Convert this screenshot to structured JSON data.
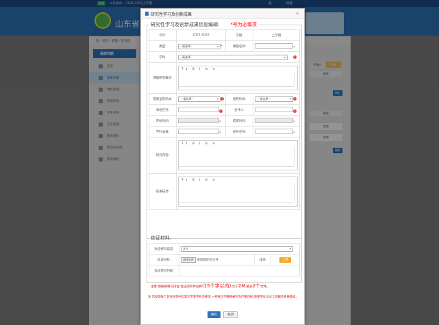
{
  "topbar": {
    "badge": "在线",
    "year": "山东省中... 2021-2022上学期",
    "user": "张",
    "loc": "地理"
  },
  "header": {
    "title": "山东省普"
  },
  "breadcrumb": "首 › 首页 › 管理 › 首页首",
  "sidebar": {
    "heading": "系统导航",
    "items": [
      {
        "label": "首页"
      },
      {
        "label": "成果记录"
      },
      {
        "label": "课程管理"
      },
      {
        "label": "成绩管理"
      },
      {
        "label": "学生名单"
      },
      {
        "label": "学业管理"
      },
      {
        "label": "我的课程"
      },
      {
        "label": "我的班学期"
      },
      {
        "label": "我的课程"
      }
    ]
  },
  "right": {
    "b1": "不通过",
    "b2": "审核",
    "hdr1": "操作",
    "hdr2": "操作",
    "view1": "查看",
    "view2": "查看",
    "go": "确定"
  },
  "modal": {
    "title": "研究性学习及创新成果",
    "close": "×",
    "section1": "研究性学习及创新成果信息编辑:",
    "required_note": "*号为必填项",
    "labels": {
      "school_year": "学年:",
      "semester": "学期:",
      "type": "类型:",
      "topic_name": "课题名称:",
      "subject": "学科:",
      "summary": "课题研究概述:",
      "result_form": "成果呈现形式:",
      "org_form": "组织形式:",
      "role": "承担任务:",
      "collaborators": "合作人:",
      "start_time": "开始时间:",
      "end_time": "结束时间:",
      "hours": "学时总数:",
      "teacher": "指导老师:",
      "content": "研究内容:",
      "description": "成果描述:"
    },
    "values": {
      "school_year": "2021-2022",
      "semester": "上学期"
    },
    "select_placeholder": "--请选择--",
    "select_placeholder2": "---请选择---",
    "editor_toolbar": "T↕ B I ☰ ☷",
    "section2": "佐证材料:",
    "evidence": {
      "type_label": "佐证材料类型:",
      "type_value": "文件",
      "file_label": "佐证材料:",
      "choose_btn": "选择文件",
      "no_file": "未选择任何文件",
      "op": "操作",
      "upload": "上传",
      "list_label": "佐证材料列表:"
    },
    "note1_pre": "注意:请按照填写内容,佐证的文件名称",
    "note1_a": "(15个字以内)",
    "note1_b": ",大小",
    "note1_c": "2M",
    "note1_d": ",最多",
    "note1_e": "2个",
    "note1_f": "文件。",
    "note2": "注:若发现每个佐证材料中出现文字等不符合要求,一经查出学籍将被列为严重违纪,请使用IE10以上的操作系统模式。",
    "save": "保存",
    "cancel": "取消"
  }
}
